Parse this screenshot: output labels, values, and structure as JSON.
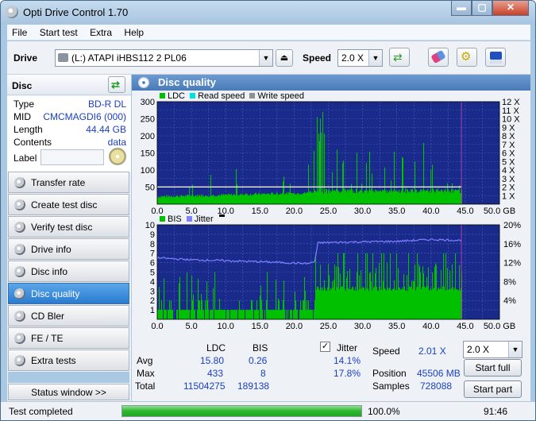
{
  "window": {
    "title": "Opti Drive Control 1.70",
    "min_label": "▬",
    "max_label": "▢",
    "close_label": "✕"
  },
  "menu": [
    "File",
    "Start test",
    "Extra",
    "Help"
  ],
  "toolbar": {
    "drive_label": "Drive",
    "drive_value": "(L:)   ATAPI iHBS112   2 PL06",
    "speed_label": "Speed",
    "speed_value": "2.0 X"
  },
  "disc": {
    "title": "Disc",
    "rows": [
      {
        "k": "Type",
        "v": "BD-R DL"
      },
      {
        "k": "MID",
        "v": "CMCMAGDI6 (000)"
      },
      {
        "k": "Length",
        "v": "44.44 GB"
      },
      {
        "k": "Contents",
        "v": "data"
      }
    ],
    "label_key": "Label"
  },
  "nav": [
    "Transfer rate",
    "Create test disc",
    "Verify test disc",
    "Drive info",
    "Disc info",
    "Disc quality",
    "CD Bler",
    "FE / TE",
    "Extra tests"
  ],
  "nav_active": 5,
  "status_window": "Status window >>",
  "panel": {
    "title": "Disc quality"
  },
  "colors": {
    "ldc": "#00c000",
    "read": "#00e0e0",
    "write": "#909090",
    "bis": "#00c000",
    "jitter": "#8080ff",
    "plot_bg": "#1a2a8a",
    "grid": "#4060c0"
  },
  "chart_data": [
    {
      "type": "bar",
      "title": "",
      "series": [
        {
          "name": "LDC"
        },
        {
          "name": "Read speed"
        },
        {
          "name": "Write speed"
        }
      ],
      "x_ticks": [
        "0.0",
        "5.0",
        "10.0",
        "15.0",
        "20.0",
        "25.0",
        "30.0",
        "35.0",
        "40.0",
        "45.0",
        "50.0 GB"
      ],
      "y_ticks": [
        "300",
        "250",
        "200",
        "150",
        "100",
        "50"
      ],
      "y2_ticks": [
        "12 X",
        "11 X",
        "10 X",
        "9 X",
        "8 X",
        "7 X",
        "6 X",
        "5 X",
        "4 X",
        "3 X",
        "2 X",
        "1 X"
      ],
      "xlim": [
        0,
        50
      ],
      "ylim": [
        0,
        300
      ],
      "data_end": 44.44,
      "ldc_avg": 15.8,
      "read_speed_x": 2.01
    },
    {
      "type": "bar",
      "title": "",
      "series": [
        {
          "name": "BIS"
        },
        {
          "name": "Jitter"
        }
      ],
      "x_ticks": [
        "0.0",
        "5.0",
        "10.0",
        "15.0",
        "20.0",
        "25.0",
        "30.0",
        "35.0",
        "40.0",
        "45.0",
        "50.0 GB"
      ],
      "y_ticks": [
        "10",
        "9",
        "8",
        "7",
        "6",
        "5",
        "4",
        "3",
        "2",
        "1"
      ],
      "y2_ticks": [
        "20%",
        "16%",
        "12%",
        "8%",
        "4%"
      ],
      "xlim": [
        0,
        50
      ],
      "ylim": [
        0,
        10
      ],
      "jitter_lim": [
        0,
        20
      ],
      "data_end": 44.44,
      "jitter_profile": [
        {
          "x": 0,
          "y": 13.0
        },
        {
          "x": 5,
          "y": 12.6
        },
        {
          "x": 10,
          "y": 12.4
        },
        {
          "x": 15,
          "y": 12.2
        },
        {
          "x": 22,
          "y": 11.8
        },
        {
          "x": 23,
          "y": 12.2
        },
        {
          "x": 23.5,
          "y": 16.2
        },
        {
          "x": 30,
          "y": 16.4
        },
        {
          "x": 35,
          "y": 16.5
        },
        {
          "x": 40,
          "y": 16.9
        },
        {
          "x": 44.4,
          "y": 16.7
        }
      ]
    }
  ],
  "stats": {
    "h_ldc": "LDC",
    "h_bis": "BIS",
    "h_jitter": "Jitter",
    "avg_label": "Avg",
    "avg_ldc": "15.80",
    "avg_bis": "0.26",
    "avg_jit": "14.1%",
    "max_label": "Max",
    "max_ldc": "433",
    "max_bis": "8",
    "max_jit": "17.8%",
    "total_label": "Total",
    "total_ldc": "11504275",
    "total_bis": "189138",
    "speed_label": "Speed",
    "speed_val": "2.01 X",
    "position_label": "Position",
    "position_val": "45506 MB",
    "samples_label": "Samples",
    "samples_val": "728088",
    "speed_combo": "2.0 X",
    "start_full": "Start full",
    "start_part": "Start part"
  },
  "status": {
    "text": "Test completed",
    "progress_text": "100.0%",
    "progress": 1.0,
    "time": "91:46"
  }
}
